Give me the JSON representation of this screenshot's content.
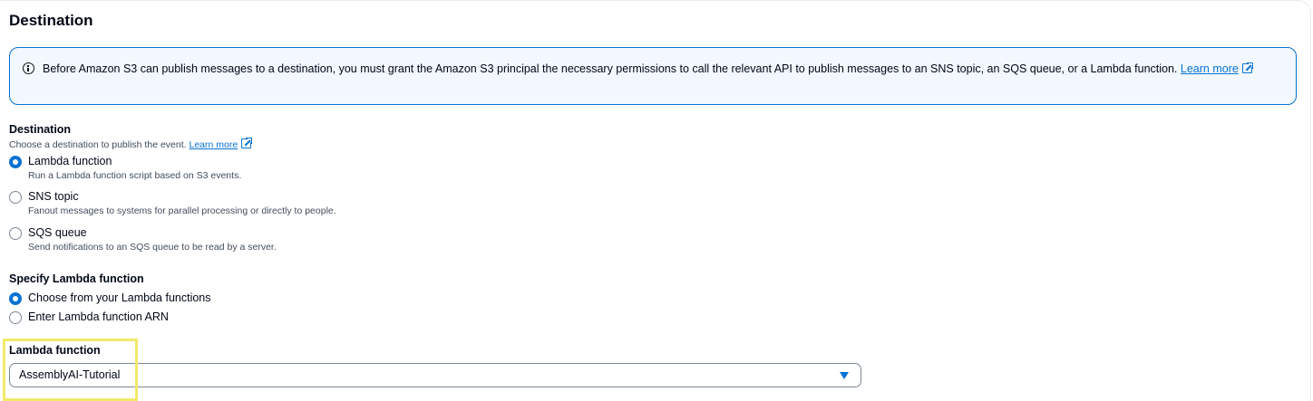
{
  "section": {
    "title": "Destination"
  },
  "alert": {
    "text": "Before Amazon S3 can publish messages to a destination, you must grant the Amazon S3 principal the necessary permissions to call the relevant API to publish messages to an SNS topic, an SQS queue, or a Lambda function.",
    "link_text": "Learn more"
  },
  "destination": {
    "label": "Destination",
    "description": "Choose a destination to publish the event.",
    "learn_more": "Learn more",
    "selected": "Lambda function",
    "options": [
      {
        "label": "Lambda function",
        "description": "Run a Lambda function script based on S3 events.",
        "checked": true
      },
      {
        "label": "SNS topic",
        "description": "Fanout messages to systems for parallel processing or directly to people.",
        "checked": false
      },
      {
        "label": "SQS queue",
        "description": "Send notifications to an SQS queue to be read by a server.",
        "checked": false
      }
    ]
  },
  "specify": {
    "label": "Specify Lambda function",
    "options": [
      {
        "label": "Choose from your Lambda functions",
        "checked": true
      },
      {
        "label": "Enter Lambda function ARN",
        "checked": false
      }
    ]
  },
  "lambda": {
    "label": "Lambda function",
    "value": "AssemblyAI-Tutorial"
  },
  "colors": {
    "accent": "#0972d3",
    "highlight": "#f0e96a",
    "alert_bg": "#f2f8fd"
  }
}
